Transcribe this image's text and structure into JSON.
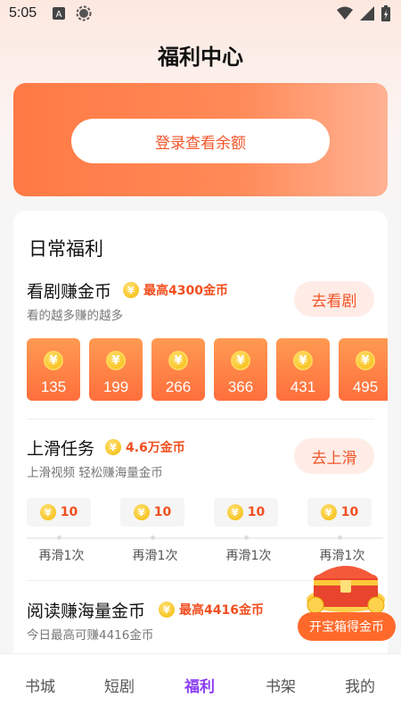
{
  "status_bar": {
    "time": "5:05"
  },
  "header": {
    "title": "福利中心"
  },
  "balance_card": {
    "login_label": "登录查看余额"
  },
  "daily": {
    "title": "日常福利",
    "watch": {
      "title": "看剧赚金币",
      "badge": "最高4300金币",
      "subtitle": "看的越多赚的越多",
      "action": "去看剧",
      "rewards": [
        "135",
        "199",
        "266",
        "366",
        "431",
        "495"
      ]
    },
    "swipe": {
      "title": "上滑任务",
      "badge": "4.6万金币",
      "subtitle": "上滑视频 轻松赚海量金币",
      "action": "去上滑",
      "steps": [
        {
          "value": "10",
          "label": "再滑1次"
        },
        {
          "value": "10",
          "label": "再滑1次"
        },
        {
          "value": "10",
          "label": "再滑1次"
        },
        {
          "value": "10",
          "label": "再滑1次"
        }
      ]
    },
    "read": {
      "title": "阅读赚海量金币",
      "badge": "最高4416金币",
      "subtitle": "今日最高可赚4416金币"
    }
  },
  "treasure": {
    "label": "开宝箱得金币"
  },
  "tabs": [
    "书城",
    "短剧",
    "福利",
    "书架",
    "我的"
  ],
  "colors": {
    "accent": "#ff7a45",
    "active_tab": "#8a3ff0",
    "badge_text": "#f24f1f"
  },
  "icons": {
    "coin": "coin-icon",
    "yuan_glyph": "¥"
  }
}
